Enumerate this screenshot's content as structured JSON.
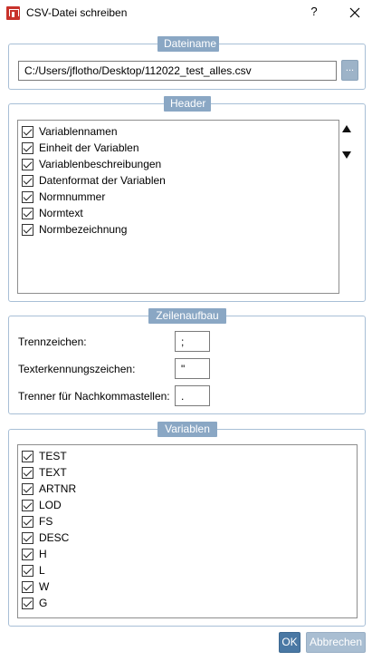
{
  "window": {
    "title": "CSV-Datei schreiben",
    "help_label": "?",
    "icon": "app-logo-icon",
    "close_icon": "close-icon"
  },
  "dateiname": {
    "legend": "Dateiname",
    "path_value": "C:/Users/jflotho/Desktop/112022_test_alles.csv",
    "browse_label": "..."
  },
  "header": {
    "legend": "Header",
    "items": [
      {
        "label": "Variablennamen",
        "checked": true
      },
      {
        "label": "Einheit der Variablen",
        "checked": true
      },
      {
        "label": "Variablenbeschreibungen",
        "checked": true
      },
      {
        "label": "Datenformat der Variablen",
        "checked": true
      },
      {
        "label": "Normnummer",
        "checked": true
      },
      {
        "label": "Normtext",
        "checked": true
      },
      {
        "label": "Normbezeichnung",
        "checked": true
      }
    ],
    "move_up_icon": "triangle-up-icon",
    "move_down_icon": "triangle-down-icon"
  },
  "zeilenaufbau": {
    "legend": "Zeilenaufbau",
    "trennzeichen_label": "Trennzeichen:",
    "trennzeichen_value": ";",
    "texterkennung_label": "Texterkennungszeichen:",
    "texterkennung_value": "\"",
    "nachkomma_label": "Trenner für Nachkommastellen:",
    "nachkomma_value": "."
  },
  "variablen": {
    "legend": "Variablen",
    "items": [
      {
        "label": "TEST",
        "checked": true
      },
      {
        "label": "TEXT",
        "checked": true
      },
      {
        "label": "ARTNR",
        "checked": true
      },
      {
        "label": "LOD",
        "checked": true
      },
      {
        "label": "FS",
        "checked": true
      },
      {
        "label": "DESC",
        "checked": true
      },
      {
        "label": "H",
        "checked": true
      },
      {
        "label": "L",
        "checked": true
      },
      {
        "label": "W",
        "checked": true
      },
      {
        "label": "G",
        "checked": true
      }
    ]
  },
  "footer": {
    "ok_label": "OK",
    "cancel_label": "Abbrechen"
  }
}
